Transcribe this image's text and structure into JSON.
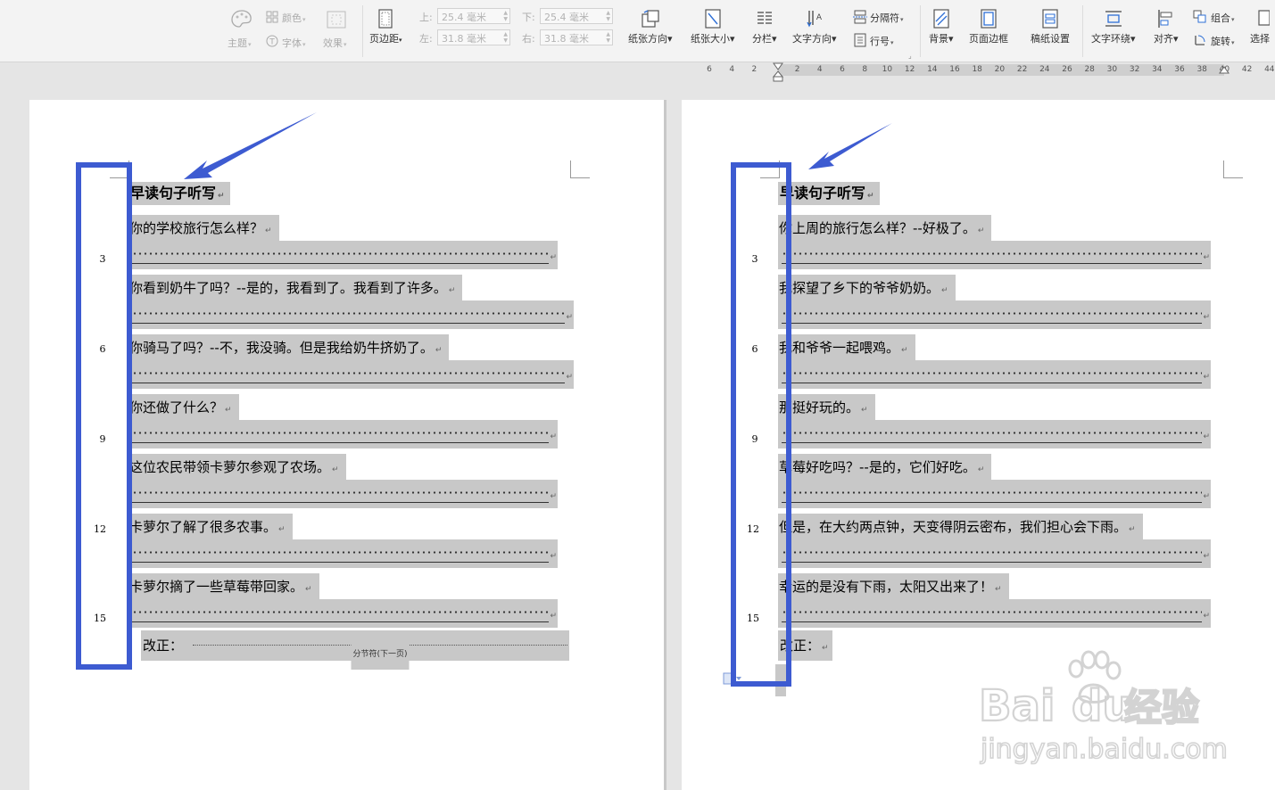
{
  "ribbon": {
    "theme": "主题",
    "color": "颜色",
    "font": "字体",
    "effect": "效果",
    "margins": "页边距",
    "top_label": "上:",
    "top_value": "25.4 毫米",
    "bottom_label": "下:",
    "bottom_value": "25.4 毫米",
    "left_label": "左:",
    "left_value": "31.8 毫米",
    "right_label": "右:",
    "right_value": "31.8 毫米",
    "orientation": "纸张方向",
    "size": "纸张大小",
    "columns": "分栏",
    "text_direction": "文字方向",
    "breaks": "分隔符",
    "line_numbers": "行号",
    "background": "背景",
    "page_border": "页面边框",
    "manuscript": "稿纸设置",
    "text_wrap": "文字环绕",
    "align": "对齐",
    "group": "组合",
    "rotate": "旋转",
    "select": "选择"
  },
  "ruler": {
    "ticks": [
      "6",
      "4",
      "2",
      "2",
      "4",
      "6",
      "8",
      "10",
      "12",
      "14",
      "16",
      "18",
      "20",
      "22",
      "24",
      "26",
      "28",
      "30",
      "32",
      "34",
      "36",
      "38",
      "40",
      "42",
      "44"
    ]
  },
  "page1": {
    "title": "早读句子听写",
    "sentences": [
      "你的学校旅行怎么样？",
      "你看到奶牛了吗？--是的，我看到了。我看到了许多。",
      "你骑马了吗？--不，我没骑。但是我给奶牛挤奶了。",
      "你还做了什么？",
      "这位农民带领卡萝尔参观了农场。",
      "卡萝尔了解了很多农事。",
      "卡萝尔摘了一些草莓带回家。"
    ],
    "line_numbers": [
      "3",
      "6",
      "9",
      "12",
      "15"
    ],
    "correction_label": "改正：",
    "section_break": "分节符(下一页)"
  },
  "page2": {
    "title": "早读句子听写",
    "sentences": [
      "你上周的旅行怎么样？--好极了。",
      "我探望了乡下的爷爷奶奶。",
      "我和爷爷一起喂鸡。",
      "那挺好玩的。",
      "草莓好吃吗？--是的，它们好吃。",
      "但是，在大约两点钟，天变得阴云密布，我们担心会下雨。",
      "幸运的是没有下雨，太阳又出来了！"
    ],
    "line_numbers": [
      "3",
      "6",
      "9",
      "12",
      "15"
    ],
    "correction_label": "改正："
  },
  "paragraph_mark": "↵",
  "watermark": {
    "brand": "Bai",
    "brand2": "du",
    "cn": "经验",
    "url": "jingyan.baidu.com"
  },
  "colors": {
    "highlight_box": "#3d5bd1",
    "selection": "#c8c8c8"
  }
}
